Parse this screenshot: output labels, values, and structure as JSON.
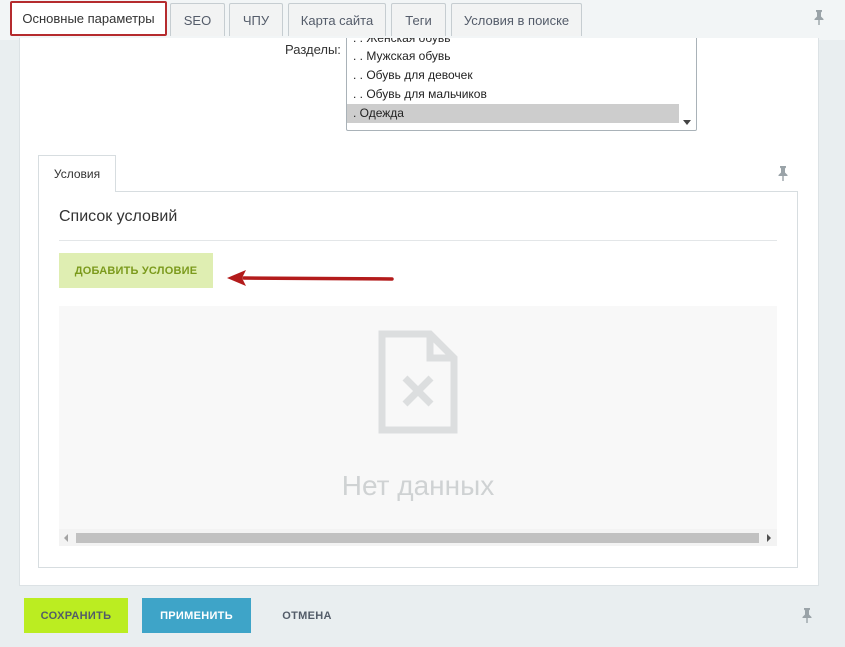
{
  "tabs": [
    {
      "label": "Основные параметры",
      "active": true
    },
    {
      "label": "SEO"
    },
    {
      "label": "ЧПУ"
    },
    {
      "label": "Карта сайта"
    },
    {
      "label": "Теги"
    },
    {
      "label": "Условия в поиске"
    }
  ],
  "sections": {
    "label": "Разделы:",
    "options": [
      ". . Женская обувь",
      ". . Мужская обувь",
      ". . Обувь для девочек",
      ". . Обувь для мальчиков",
      ". Одежда"
    ],
    "selected": ". Одежда"
  },
  "conditions": {
    "tab_label": "Условия",
    "title": "Список условий",
    "add_label": "ДОБАВИТЬ УСЛОВИЕ",
    "empty_text": "Нет данных"
  },
  "footer": {
    "save_label": "СОХРАНИТЬ",
    "apply_label": "ПРИМЕНИТЬ",
    "cancel_label": "ОТМЕНА"
  },
  "colors": {
    "active_tab_border": "#b52b2e",
    "save_bg": "#bbed21",
    "apply_bg": "#3ea4c8",
    "add_bg": "#dfeeb2",
    "annotation_arrow": "#b31b1b"
  },
  "icons": [
    "pin-icon",
    "no-data-file-icon",
    "red-arrow-annotation"
  ]
}
